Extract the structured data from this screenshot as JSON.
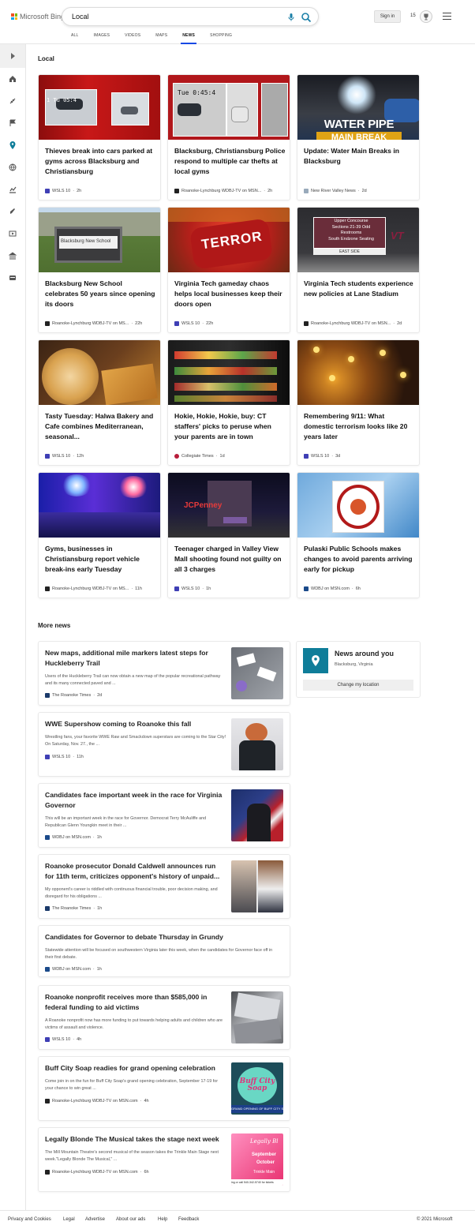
{
  "header": {
    "brand": "Microsoft Bing",
    "search_query": "Local",
    "sign_in": "Sign in",
    "rewards_points": "15",
    "tabs": [
      {
        "label": "ALL"
      },
      {
        "label": "IMAGES"
      },
      {
        "label": "VIDEOS"
      },
      {
        "label": "MAPS"
      },
      {
        "label": "NEWS",
        "active": true
      },
      {
        "label": "SHOPPING"
      }
    ]
  },
  "sidebar": {
    "icons": [
      "expand-icon",
      "home-icon",
      "sports-icon",
      "flag-icon",
      "location-icon",
      "globe-icon",
      "finance-icon",
      "science-icon",
      "entertainment-icon",
      "politics-icon",
      "technology-icon"
    ]
  },
  "local": {
    "heading": "Local",
    "cards": [
      {
        "title": "Thieves break into cars parked at gyms across Blacksburg and Christiansburg",
        "source": "WSLS 10",
        "time": "2h",
        "img_overlay": "1 Tu  05:4"
      },
      {
        "title": "Blacksburg, Christiansburg Police respond to multiple car thefts at local gyms",
        "source": "Roanoke-Lynchburg WDBJ-TV on MSN...",
        "time": "2h",
        "img_overlay": "Tue 0:45:4"
      },
      {
        "title": "Update: Water Main Breaks in Blacksburg",
        "source": "New River Valley News",
        "time": "2d",
        "img_overlay": "WATER PIPE",
        "img_overlay2": "MAIN BREAK"
      },
      {
        "title": "Blacksburg New School celebrates 50 years since opening its doors",
        "source": "Roanoke-Lynchburg WDBJ-TV on MS...",
        "time": "22h",
        "img_overlay": "Blacksburg New School"
      },
      {
        "title": "Virginia Tech gameday chaos helps local businesses keep their doors open",
        "source": "WSLS 10",
        "time": "22h",
        "img_overlay": "TERROR"
      },
      {
        "title": "Virginia Tech students experience new policies at Lane Stadium",
        "source": "Roanoke-Lynchburg WDBJ-TV on MSN...",
        "time": "2d",
        "img_lines": [
          "Upper Concourse",
          "Sections 21-39 Odd",
          "Restrooms",
          "South Endzone Seating"
        ],
        "img_footer": "EAST SIDE",
        "img_logo": "VT"
      },
      {
        "title": "Tasty Tuesday: Halwa Bakery and Cafe combines Mediterranean, seasonal...",
        "source": "WSLS 10",
        "time": "12h"
      },
      {
        "title": "Hokie, Hokie, Hokie, buy: CT staffers' picks to peruse when your parents are in town",
        "source": "Collegiate Times",
        "time": "1d"
      },
      {
        "title": "Remembering 9/11: What domestic terrorism looks like 20 years later",
        "source": "WSLS 10",
        "time": "3d"
      },
      {
        "title": "Gyms, businesses in Christiansburg report vehicle break-ins early Tuesday",
        "source": "Roanoke-Lynchburg WDBJ-TV on MS...",
        "time": "11h"
      },
      {
        "title": "Teenager charged in Valley View Mall shooting found not guilty on all 3 charges",
        "source": "WSLS 10",
        "time": "1h",
        "img_overlay": "JCPenney"
      },
      {
        "title": "Pulaski Public Schools makes changes to avoid parents arriving early for pickup",
        "source": "WDBJ on MSN.com",
        "time": "6h"
      }
    ]
  },
  "more_news": {
    "heading": "More news",
    "items": [
      {
        "title": "New maps, additional mile markers latest steps for Huckleberry Trail",
        "snippet": "Users of the Huckleberry Trail can now obtain a new map of the popular recreational pathway and its many connected paved and ...",
        "source": "The Roanoke Times",
        "time": "2d"
      },
      {
        "title": "WWE Supershow coming to Roanoke this fall",
        "snippet": "Wrestling fans, your favorite WWE Raw and Smackdown superstars are coming to the Star City! On Saturday, Nov. 27., the ...",
        "source": "WSLS 10",
        "time": "11h"
      },
      {
        "title": "Candidates face important week in the race for Virginia Governor",
        "snippet": "This will be an important week in the race for Governor. Democrat Terry McAuliffe and Republican Glenn Youngkin meet in their ...",
        "source": "WDBJ on MSN.com",
        "time": "1h"
      },
      {
        "title": "Roanoke prosecutor Donald Caldwell announces run for 11th term, criticizes opponent's history of unpaid...",
        "snippet": "My opponent's career is riddled with continuous financial trouble, poor decision making, and disregard for his obligations ...",
        "source": "The Roanoke Times",
        "time": "1h"
      },
      {
        "title": "Candidates for Governor to debate Thursday in Grundy",
        "snippet": "Statewide attention will be focused on southwestern Virginia later this week, when the candidates for Governor face off in their first debate.",
        "source": "WDBJ on MSN.com",
        "time": "1h"
      },
      {
        "title": "Roanoke nonprofit receives more than $585,000 in federal funding to aid victims",
        "snippet": "A Roanoke nonprofit now has more funding to put towards helping adults and children who are victims of assault and violence.",
        "source": "WSLS 10",
        "time": "4h"
      },
      {
        "title": "Buff City Soap readies for grand opening celebration",
        "snippet": "Come join in on the fun for Buff City Soap's grand opening celebration, September 17-19 for your chance to win great ...",
        "source": "Roanoke-Lynchburg WDBJ-TV on MSN.com",
        "time": "4h",
        "thumb_text": "Buff City Soap",
        "thumb_banner": "GRAND OPENING OF BUFF CITY SOAP!"
      },
      {
        "title": "Legally Blonde The Musical takes the stage next week",
        "snippet": "The Mill Mountain Theatre's second musical of the season takes the Trinkle Main Stage next week.\"Legally Blonde The Musical,\" ...",
        "source": "Roanoke-Lynchburg WDBJ-TV on MSN.com",
        "time": "6h",
        "thumb_lines": [
          "Legally Bl",
          "September",
          "October",
          "Trinkle Main"
        ],
        "thumb_foot": "ing or call 540-342-5740 for tickets"
      }
    ]
  },
  "news_around": {
    "title": "News around you",
    "location": "Blacksburg, Virginia",
    "button": "Change my location"
  },
  "footer": {
    "links": [
      "Privacy and Cookies",
      "Legal",
      "Advertise",
      "About our ads",
      "Help",
      "Feedback"
    ],
    "copyright": "© 2021 Microsoft"
  },
  "colors": {
    "accent": "#174ae4",
    "location_tile": "#0f7d99",
    "wsls": "#3f3fb5"
  }
}
